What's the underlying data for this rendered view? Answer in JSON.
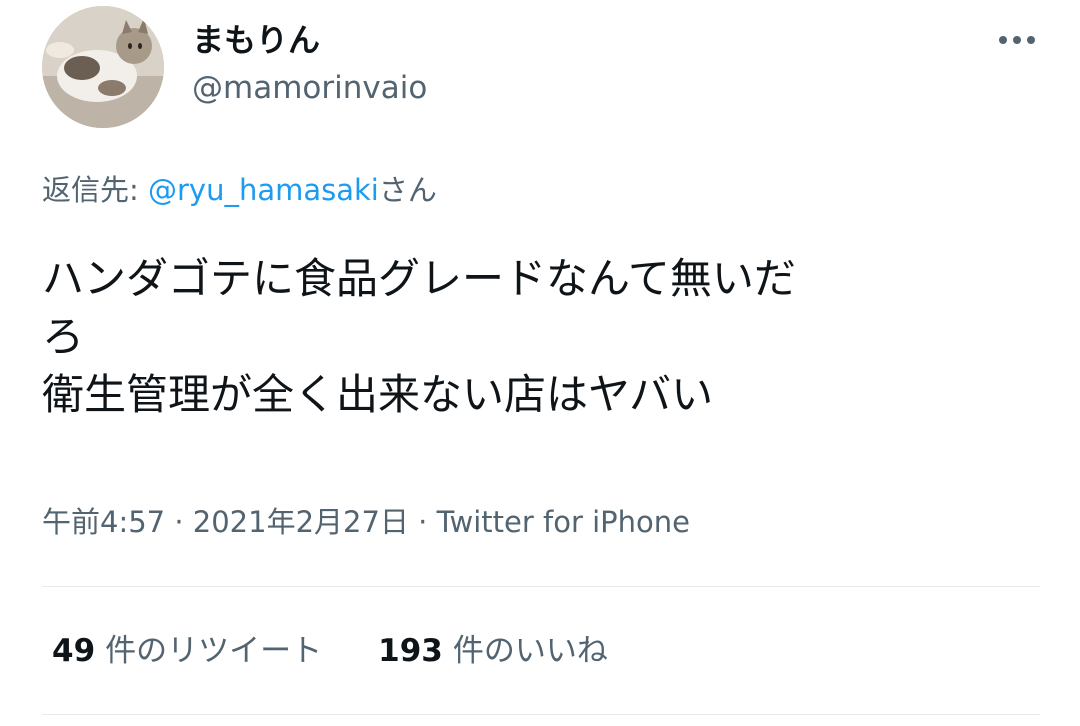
{
  "author": {
    "display_name": "まもりん",
    "handle": "@mamorinvaio",
    "avatar_icon": "cat-avatar-icon"
  },
  "header": {
    "more_icon": "more-horizontal-icon"
  },
  "reply_to": {
    "prefix": "返信先: ",
    "mention": "@ryu_hamasaki",
    "suffix": "さん"
  },
  "tweet": {
    "lines": [
      "ハンダゴテに食品グレードなんて無いだ",
      "ろ",
      "衛生管理が全く出来ない店はヤバい"
    ]
  },
  "meta": {
    "time": "午前4:57",
    "sep1": " · ",
    "date": "2021年2月27日",
    "sep2": " · ",
    "source": "Twitter for iPhone"
  },
  "stats": {
    "retweets": {
      "count": "49",
      "label": "件のリツイート"
    },
    "likes": {
      "count": "193",
      "label": "件のいいね"
    }
  },
  "colors": {
    "text": "#0f1419",
    "secondary": "#536471",
    "link": "#1d9bf0",
    "divider": "#e6ecf0"
  }
}
